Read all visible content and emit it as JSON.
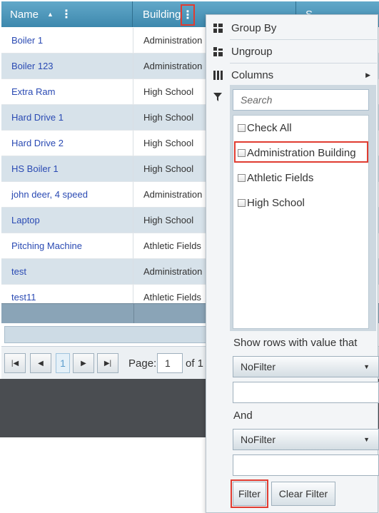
{
  "grid": {
    "columns": {
      "name": "Name",
      "building": "Building",
      "third": "S"
    },
    "rows": [
      {
        "name": "Boiler 1",
        "building": "Administration"
      },
      {
        "name": "Boiler 123",
        "building": "Administration"
      },
      {
        "name": "Extra Ram",
        "building": "High School"
      },
      {
        "name": "Hard Drive 1",
        "building": "High School"
      },
      {
        "name": "Hard Drive 2",
        "building": "High School"
      },
      {
        "name": "HS Boiler 1",
        "building": "High School"
      },
      {
        "name": "john deer, 4 speed",
        "building": "Administration"
      },
      {
        "name": "Laptop",
        "building": "High School"
      },
      {
        "name": "Pitching Machine",
        "building": "Athletic Fields"
      },
      {
        "name": "test",
        "building": "Administration"
      },
      {
        "name": "test11",
        "building": "Athletic Fields"
      }
    ]
  },
  "pager": {
    "page_number": "1",
    "page_label": "Page:",
    "page_input": "1",
    "of_label": "of 1"
  },
  "menu": {
    "group_by": "Group By",
    "ungroup": "Ungroup",
    "columns": "Columns",
    "search_placeholder": "Search",
    "options": [
      "Check All",
      "Administration Building",
      "Athletic Fields",
      "High School"
    ],
    "show_rows_label": "Show rows with value that",
    "first_operator": "NoFilter",
    "and_label": "And",
    "second_operator": "NoFilter",
    "filter_button": "Filter",
    "clear_filter_button": "Clear Filter"
  },
  "colors": {
    "header": "#4a97bd",
    "highlight": "#e03c31",
    "link": "#2a4ab3"
  }
}
